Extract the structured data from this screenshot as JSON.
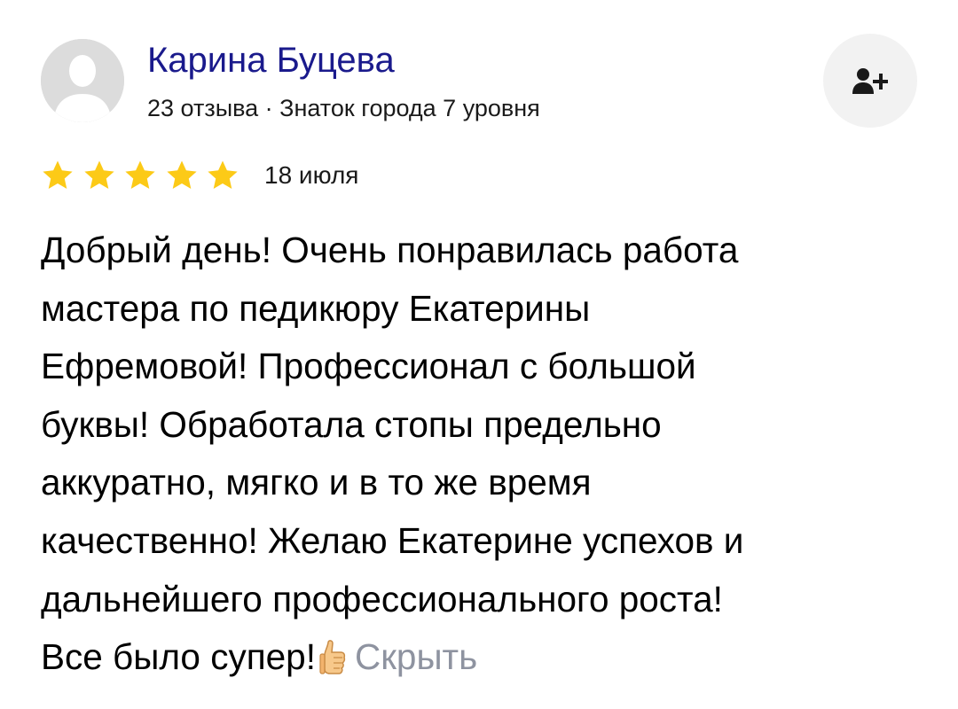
{
  "author": {
    "name": "Карина Буцева",
    "meta": "23 отзыва · Знаток города 7 уровня",
    "avatar_icon": "user-placeholder-icon"
  },
  "subscribe": {
    "icon": "add-user-icon"
  },
  "rating": {
    "value": 5,
    "max": 5,
    "star_color": "#fcca17"
  },
  "date": "18 июля",
  "review": {
    "lines": [
      "Добрый день! Очень понравилась работа",
      "мастера по педикюру Екатерины",
      "Ефремовой! Профессионал с большой",
      "буквы! Обработала стопы предельно",
      "аккуратно, мягко и в то же время",
      "качественно! Желаю Екатерине успехов и",
      "дальнейшего профессионального роста!",
      "Все было супер!"
    ],
    "emoji_icon": "thumbs-up-icon",
    "hide_label": "Скрыть"
  },
  "colors": {
    "author_name": "#1a1a8c",
    "hide_link": "#8e93a0",
    "button_bg": "#f2f2f2"
  }
}
